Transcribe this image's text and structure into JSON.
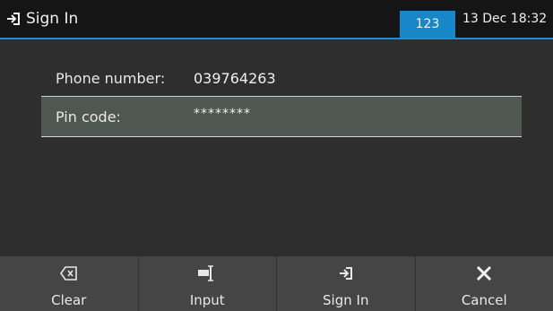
{
  "header": {
    "icon": "sign-in-icon",
    "title": "Sign In",
    "badge": "123",
    "datetime": "13 Dec 18:32",
    "accent_color": "#1a8fd6"
  },
  "form": {
    "phone_label": "Phone number:",
    "phone_value": "039764263",
    "pin_label": "Pin code:",
    "pin_value": "********"
  },
  "softkeys": [
    {
      "label": "Clear",
      "icon": "backspace-icon"
    },
    {
      "label": "Input",
      "icon": "input-mode-icon"
    },
    {
      "label": "Sign In",
      "icon": "sign-in-icon"
    },
    {
      "label": "Cancel",
      "icon": "close-icon"
    }
  ]
}
